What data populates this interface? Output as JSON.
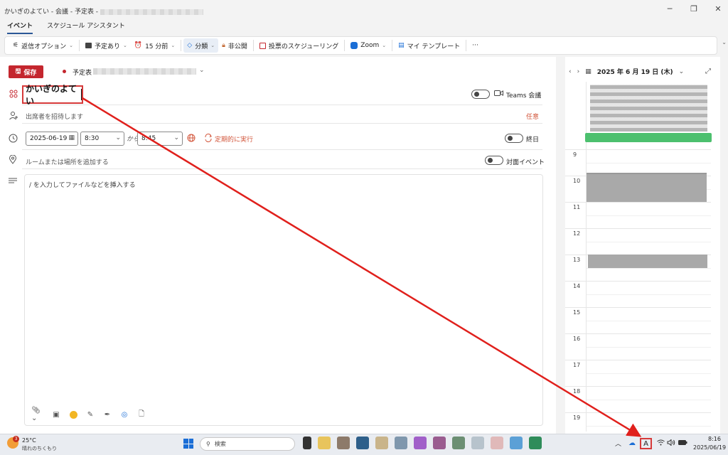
{
  "window": {
    "title": "かいぎのよてい - 会議 - 予定表 -",
    "minimize_icon": "minimize-icon",
    "restore_icon": "restore-icon",
    "close_icon": "close-icon"
  },
  "tabs": [
    {
      "label": "イベント",
      "active": true
    },
    {
      "label": "スケジュール アシスタント",
      "active": false
    }
  ],
  "ribbon": {
    "reply_options": "返信オプション",
    "busy_status": "予定あり",
    "reminder": "15 分前",
    "categorize": "分類",
    "private": "非公開",
    "scheduling_poll": "投票のスケジューリング",
    "zoom": "Zoom",
    "my_templates": "マイ テンプレート",
    "more": "···"
  },
  "form": {
    "save_label": "保存",
    "calendar_label": "予定表",
    "title_value": "かいぎのよてい",
    "teams_label": "Teams 会議",
    "teams_on": false,
    "attendees_placeholder": "出席者を招待します",
    "optional_label": "任意",
    "start_date": "2025-06-19",
    "start_time": "8:30",
    "to_label": "から",
    "end_time": "8:45",
    "recurrence_label": "定期的に実行",
    "allday_label": "終日",
    "allday_on": false,
    "room_placeholder": "ルームまたは場所を追加する",
    "inperson_label": "対面イベント",
    "inperson_on": false,
    "body_placeholder": "/ を入力してファイルなどを挿入する"
  },
  "calendar": {
    "date_header": "2025 年 6 月 19 日 (木)",
    "hours": [
      "9",
      "10",
      "11",
      "12",
      "13",
      "14",
      "15",
      "16",
      "17",
      "18",
      "19"
    ],
    "allday_event_color": "#4cc06e"
  },
  "taskbar": {
    "weather_temp": "25°C",
    "weather_desc": "晴れのちくもり",
    "weather_badge": "3",
    "search_placeholder": "検索",
    "ime_indicator": "A",
    "time": "8:16",
    "date": "2025/06/19"
  },
  "colors": {
    "accent_red": "#c4262e",
    "annotation_red": "#e0201c",
    "link_orange": "#d2553a"
  }
}
